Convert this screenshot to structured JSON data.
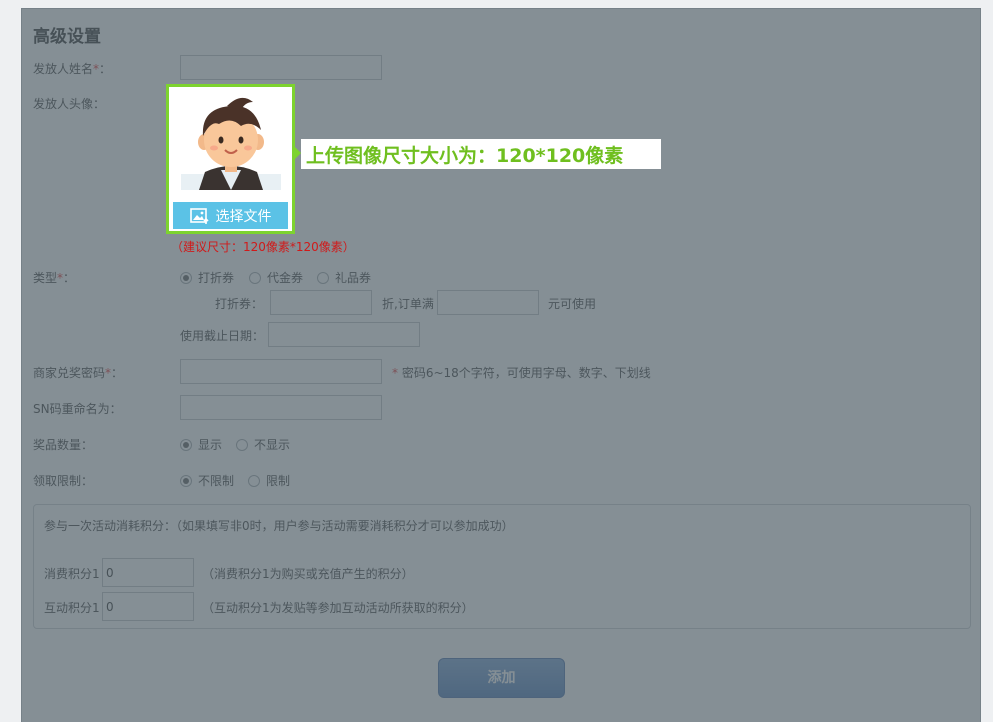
{
  "section_title": "高级设置",
  "issuer_name": {
    "label": "发放人姓名",
    "required_mark": "*",
    "colon": "：",
    "value": ""
  },
  "issuer_avatar": {
    "label": "发放人头像：",
    "select_file_label": "选择文件",
    "callout_text": "上传图像尺寸大小为：120*120像素",
    "size_hint": "（建议尺寸：120像素*120像素）"
  },
  "type": {
    "label": "类型",
    "required_mark": "*",
    "colon": "：",
    "options": [
      "打折券",
      "代金券",
      "礼品券"
    ],
    "selected_index": 0,
    "discount_label": "打折券：",
    "discount_value": "",
    "discount_suffix": "折,订单满",
    "order_min_value": "",
    "order_min_suffix": "元可使用",
    "deadline_label": "使用截止日期：",
    "deadline_value": ""
  },
  "merchant_password": {
    "label": "商家兑奖密码",
    "required_mark": "*",
    "colon": "：",
    "value": "",
    "hint_mark": "*",
    "hint": " 密码6~18个字符，可使用字母、数字、下划线"
  },
  "sn_rename": {
    "label": "SN码重命名为：",
    "value": ""
  },
  "prize_count": {
    "label": "奖品数量：",
    "options": [
      "显示",
      "不显示"
    ],
    "selected_index": 0
  },
  "claim_limit": {
    "label": "领取限制：",
    "options": [
      "不限制",
      "限制"
    ],
    "selected_index": 0
  },
  "points": {
    "legend": "参与一次活动消耗积分：（如果填写非0时，用户参与活动需要消耗积分才可以参加成功）",
    "consume_label": "消费积分1",
    "consume_value": "0",
    "consume_hint": "（消费积分1为购买或充值产生的积分）",
    "interact_label": "互动积分1",
    "interact_value": "0",
    "interact_hint": "（互动积分1为发贴等参加互动活动所获取的积分）"
  },
  "submit_label": "添加",
  "colors": {
    "highlight_green": "#7dd32f",
    "upload_blue": "#5bc2e6",
    "button_blue": "#3f71b3",
    "required_red": "#e02020"
  }
}
